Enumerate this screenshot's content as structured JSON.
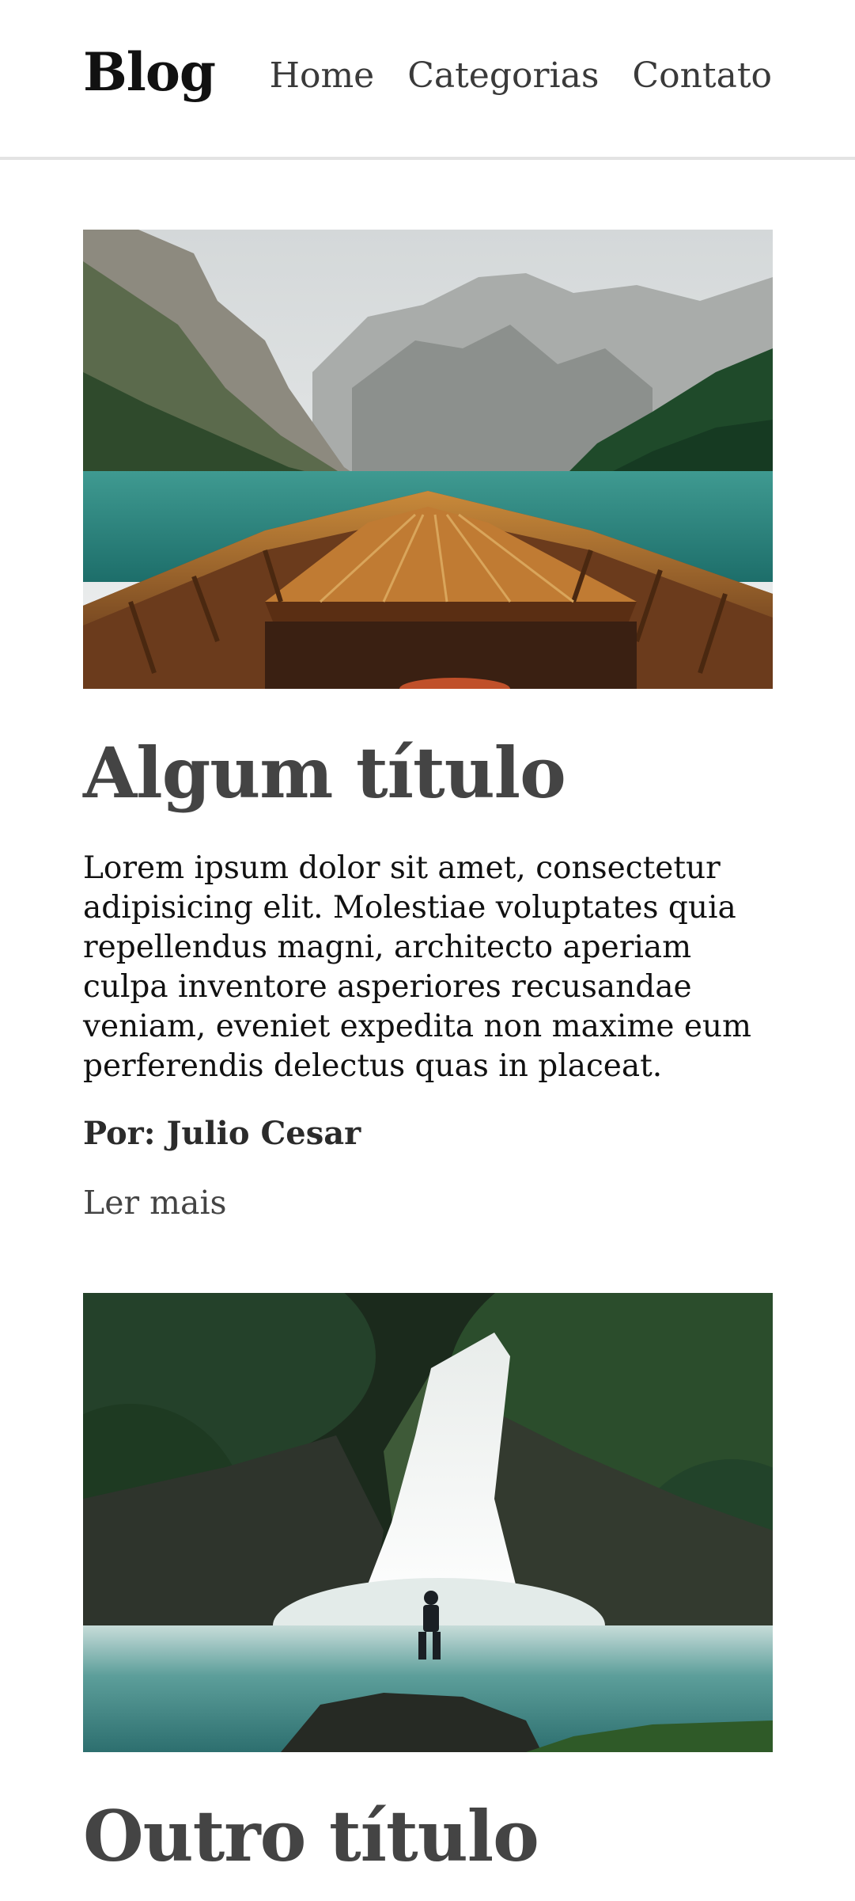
{
  "header": {
    "brand": "Blog",
    "nav": [
      "Home",
      "Categorias",
      "Contato"
    ]
  },
  "posts": [
    {
      "image": "mountain-lake-boat-bow",
      "title": "Algum título",
      "excerpt": "Lorem ipsum dolor sit amet, consectetur adipisicing elit. Molestiae voluptates quia repellendus magni, architecto aperiam culpa inventore asperiores recusandae veniam, eveniet expedita non maxime eum perferendis delectus quas in placeat.",
      "author": "Por: Julio Cesar",
      "read_more": "Ler mais"
    },
    {
      "image": "forest-waterfall-person",
      "title": "Outro título"
    }
  ],
  "colors": {
    "text": "#111111",
    "heading": "#444444",
    "divider": "#e3e3e3"
  }
}
